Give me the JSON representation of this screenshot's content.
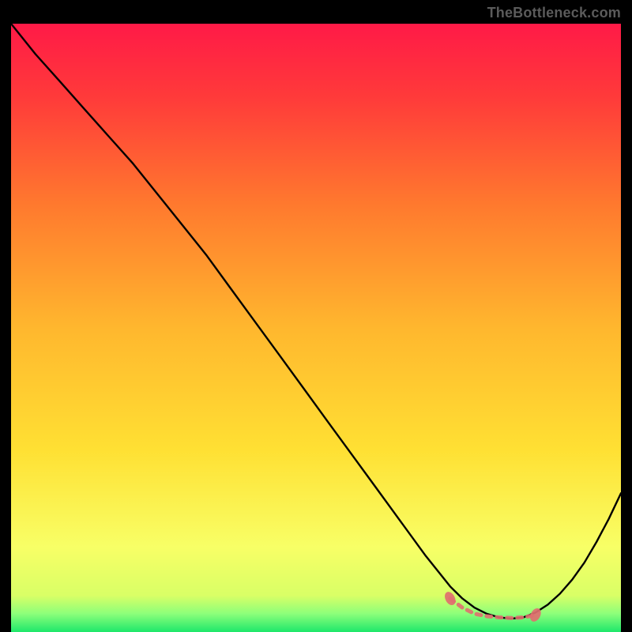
{
  "attribution": "TheBottleneck.com",
  "colors": {
    "black": "#000000",
    "gradient_top": "#ff1a47",
    "gradient_mid": "#ffe033",
    "gradient_low": "#f8ff66",
    "gradient_green": "#1ee86b",
    "curve": "#000000",
    "marker_fill": "#e06f6f",
    "marker_alt": "#6a2a2a"
  },
  "chart_data": {
    "type": "line",
    "title": "",
    "xlabel": "",
    "ylabel": "",
    "xlim": [
      0,
      100
    ],
    "ylim": [
      0,
      100
    ],
    "grid": false,
    "legend": false,
    "series": [
      {
        "name": "curve",
        "x": [
          0,
          4,
          8,
          12,
          16,
          20,
          24,
          28,
          32,
          36,
          40,
          44,
          48,
          52,
          56,
          60,
          64,
          68,
          72,
          74,
          76,
          78,
          80,
          82,
          84,
          86,
          88,
          90,
          92,
          94,
          96,
          98,
          100
        ],
        "y": [
          100,
          95,
          90.5,
          86,
          81.5,
          77,
          72,
          67,
          62,
          56.5,
          51,
          45.5,
          40,
          34.5,
          29,
          23.5,
          18,
          12.5,
          7.5,
          5.5,
          4.0,
          3.0,
          2.4,
          2.2,
          2.4,
          3.2,
          4.5,
          6.3,
          8.6,
          11.4,
          14.8,
          18.6,
          22.8
        ]
      }
    ],
    "markers": {
      "x": [
        72,
        74,
        76,
        78,
        80,
        82,
        84,
        86
      ],
      "y": [
        5.5,
        4.0,
        3.0,
        2.6,
        2.4,
        2.3,
        2.4,
        2.8
      ]
    }
  }
}
